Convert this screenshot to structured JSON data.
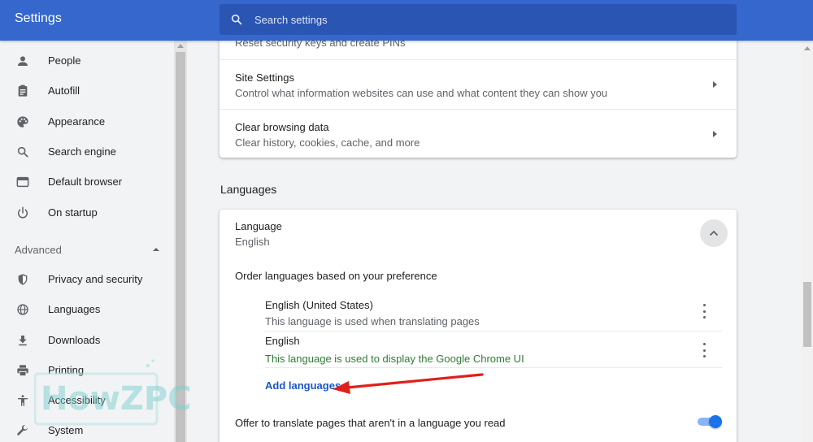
{
  "header": {
    "title": "Settings",
    "search_placeholder": "Search settings"
  },
  "sidebar": {
    "items": [
      {
        "label": "People",
        "icon": "person-icon"
      },
      {
        "label": "Autofill",
        "icon": "clipboard-icon"
      },
      {
        "label": "Appearance",
        "icon": "palette-icon"
      },
      {
        "label": "Search engine",
        "icon": "search-icon"
      },
      {
        "label": "Default browser",
        "icon": "browser-window-icon"
      },
      {
        "label": "On startup",
        "icon": "power-icon"
      }
    ],
    "advanced_label": "Advanced",
    "advanced_items": [
      {
        "label": "Privacy and security",
        "icon": "shield-icon"
      },
      {
        "label": "Languages",
        "icon": "globe-icon"
      },
      {
        "label": "Downloads",
        "icon": "download-icon"
      },
      {
        "label": "Printing",
        "icon": "printer-icon"
      },
      {
        "label": "Accessibility",
        "icon": "accessibility-icon"
      },
      {
        "label": "System",
        "icon": "wrench-icon"
      }
    ]
  },
  "main": {
    "top_card": {
      "cut_row_sub": "Reset security keys and create PINs",
      "rows": [
        {
          "title": "Site Settings",
          "sub": "Control what information websites can use and what content they can show you"
        },
        {
          "title": "Clear browsing data",
          "sub": "Clear history, cookies, cache, and more"
        }
      ]
    },
    "languages": {
      "heading": "Languages",
      "language_label": "Language",
      "language_value": "English",
      "order_label": "Order languages based on your preference",
      "entries": [
        {
          "name": "English (United States)",
          "desc": "This language is used when translating pages"
        },
        {
          "name": "English",
          "desc": "This language is used to display the Google Chrome UI"
        }
      ],
      "add_languages": "Add languages",
      "offer_translate": "Offer to translate pages that aren't in a language you read",
      "offer_translate_enabled": true
    }
  },
  "watermark": {
    "text": "HowZPC"
  },
  "colors": {
    "header_bg": "#3567cc",
    "search_bg": "#2a55b3",
    "link_blue": "#1a57c7",
    "ui_lang_green": "#2e7d32",
    "toggle_blue": "#1a73e8",
    "arrow_red": "#e0201c"
  }
}
